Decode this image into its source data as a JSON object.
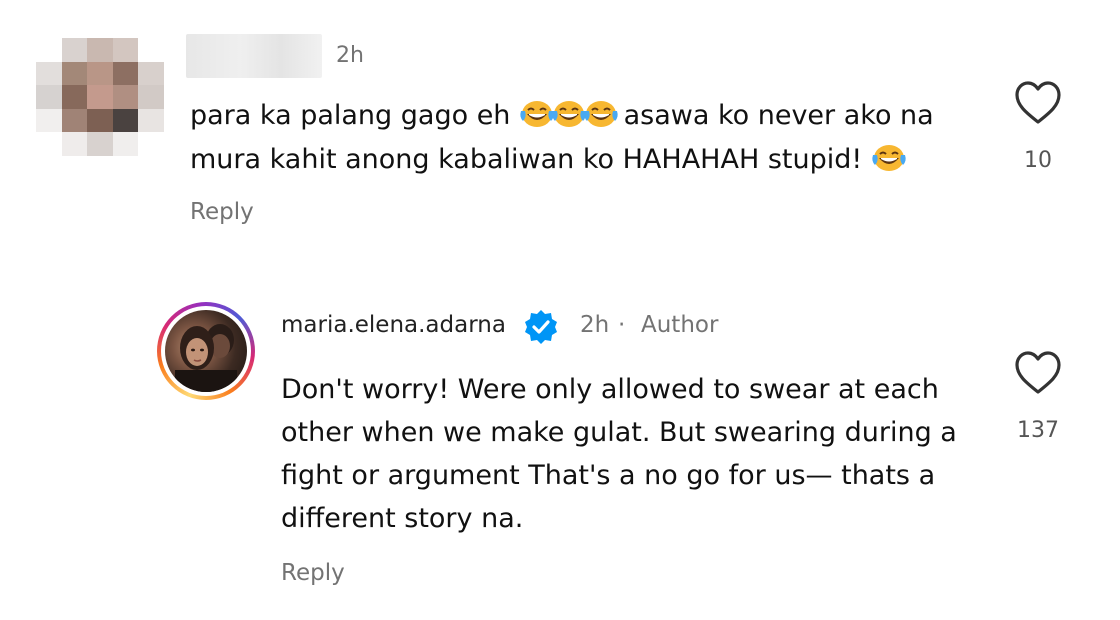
{
  "comments": [
    {
      "time": "2h",
      "text_before_emoji": "para ka palang gago eh ",
      "text_after_emoji": " asawa ko never ako na mura kahit anong kabaliwan ko HAHAHAH stupid! ",
      "emoji_icon": "face-with-tears-of-joy-icon",
      "reply_label": "Reply",
      "likes": "10"
    },
    {
      "username": "maria.elena.adarna",
      "verified_icon": "verified-badge-icon",
      "time": "2h",
      "separator": "·",
      "badge": "Author",
      "text": "Don't worry! Were only allowed to swear at each other when we make gulat. But swearing during a fight or argument That's a no go for us— thats a different story na.",
      "reply_label": "Reply",
      "likes": "137"
    }
  ],
  "colors": {
    "secondary_text": "#737373",
    "verified_blue": "#0095f6",
    "emoji_yellow": "#f7b731",
    "tear_blue": "#49a9f2"
  },
  "icons": {
    "like": "heart-outline-icon"
  }
}
